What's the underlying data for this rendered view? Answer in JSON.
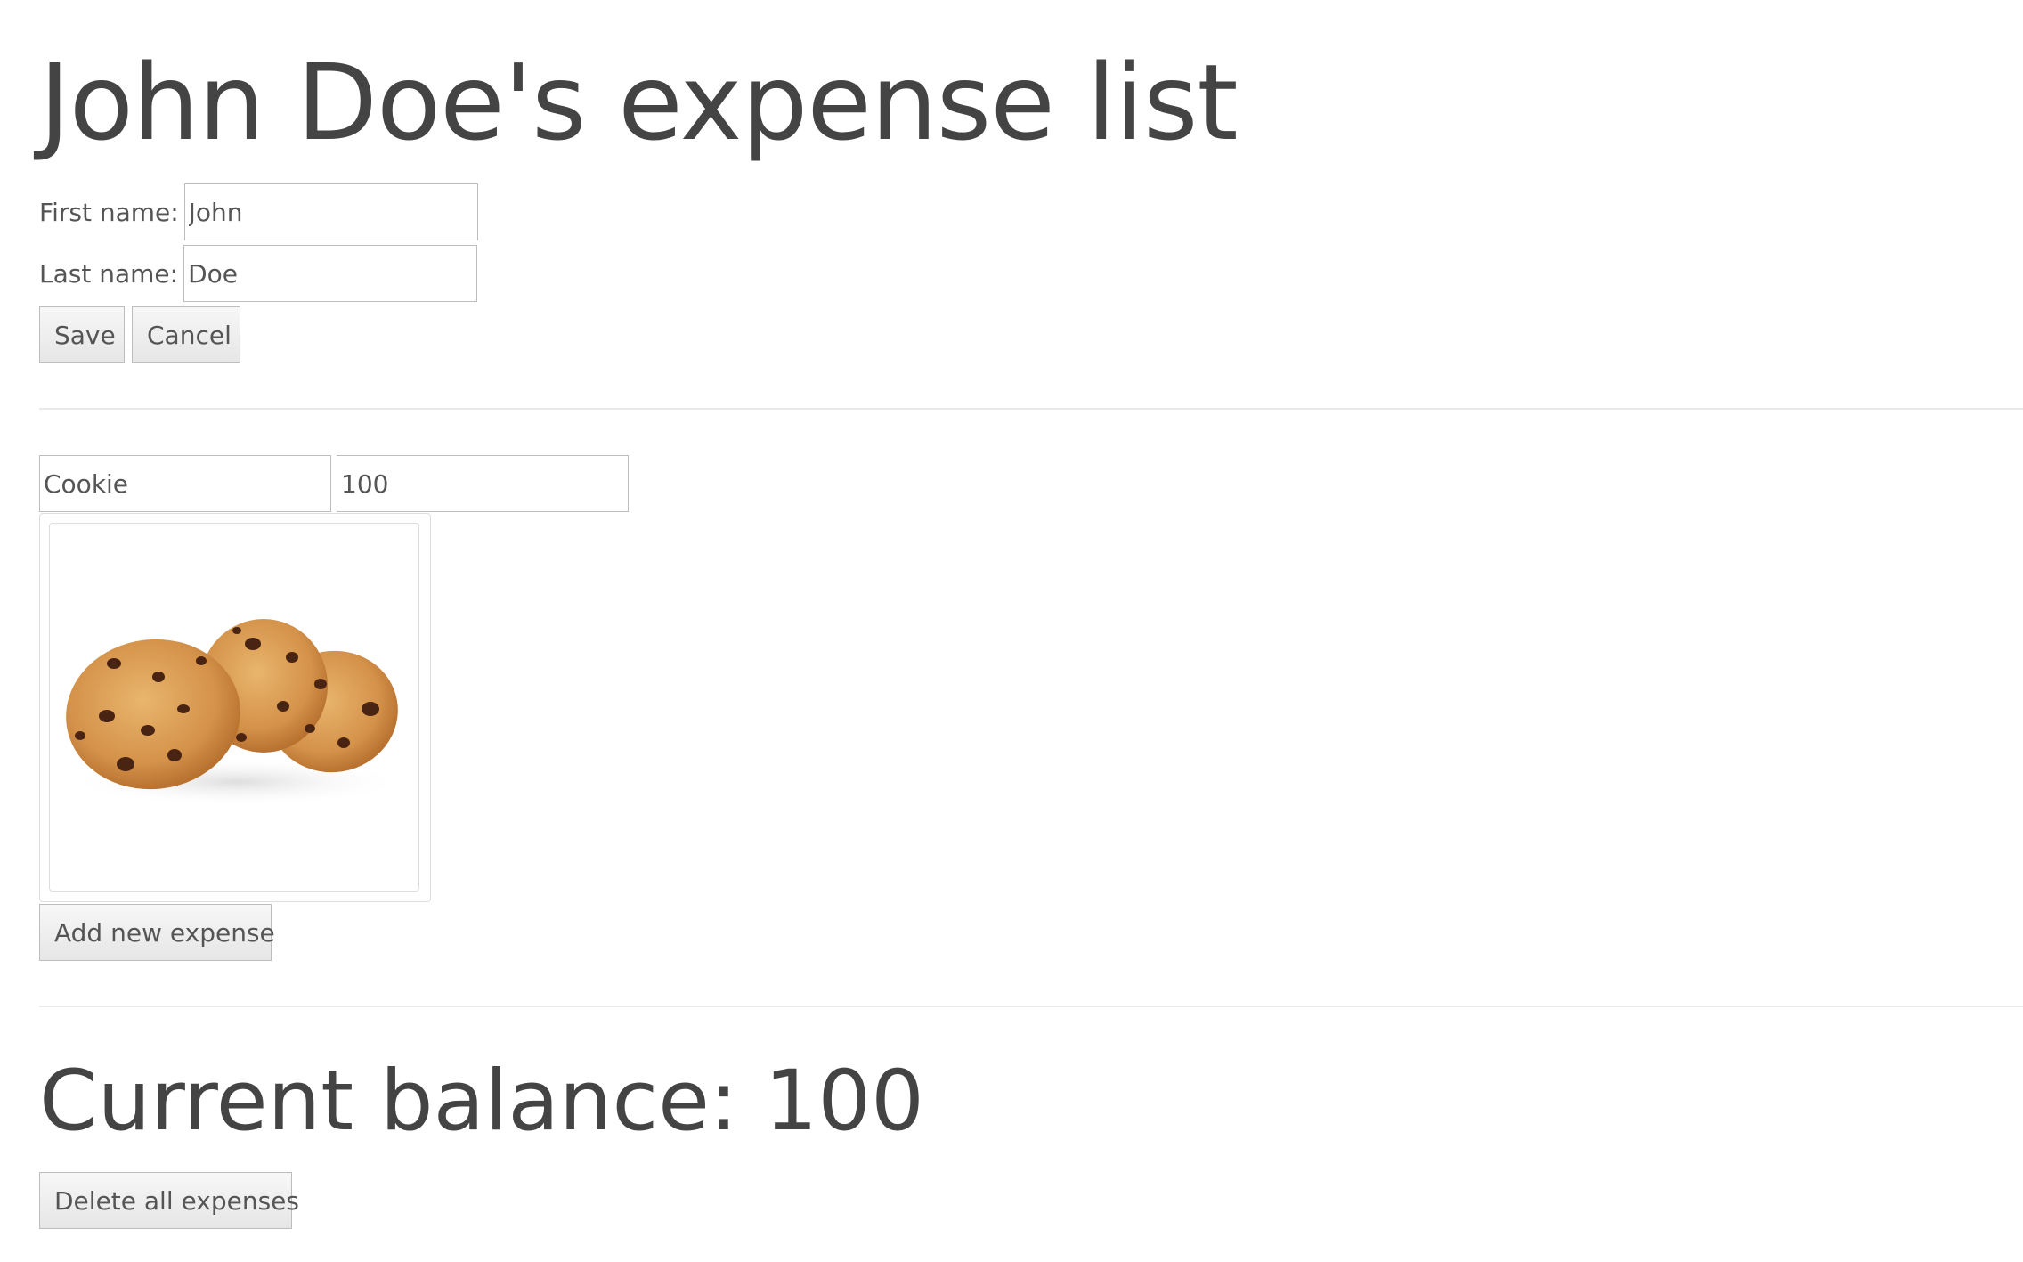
{
  "header": {
    "title": "John Doe's expense list"
  },
  "profile_form": {
    "first_name_label": "First name:",
    "first_name_value": "John",
    "last_name_label": "Last name:",
    "last_name_value": "Doe",
    "save_label": "Save",
    "cancel_label": "Cancel"
  },
  "expense_form": {
    "name_value": "Cookie",
    "amount_value": "100",
    "image_icon": "cookie-image",
    "add_label": "Add new expense"
  },
  "summary": {
    "balance_label": "Current balance: 100",
    "delete_all_label": "Delete all expenses"
  }
}
